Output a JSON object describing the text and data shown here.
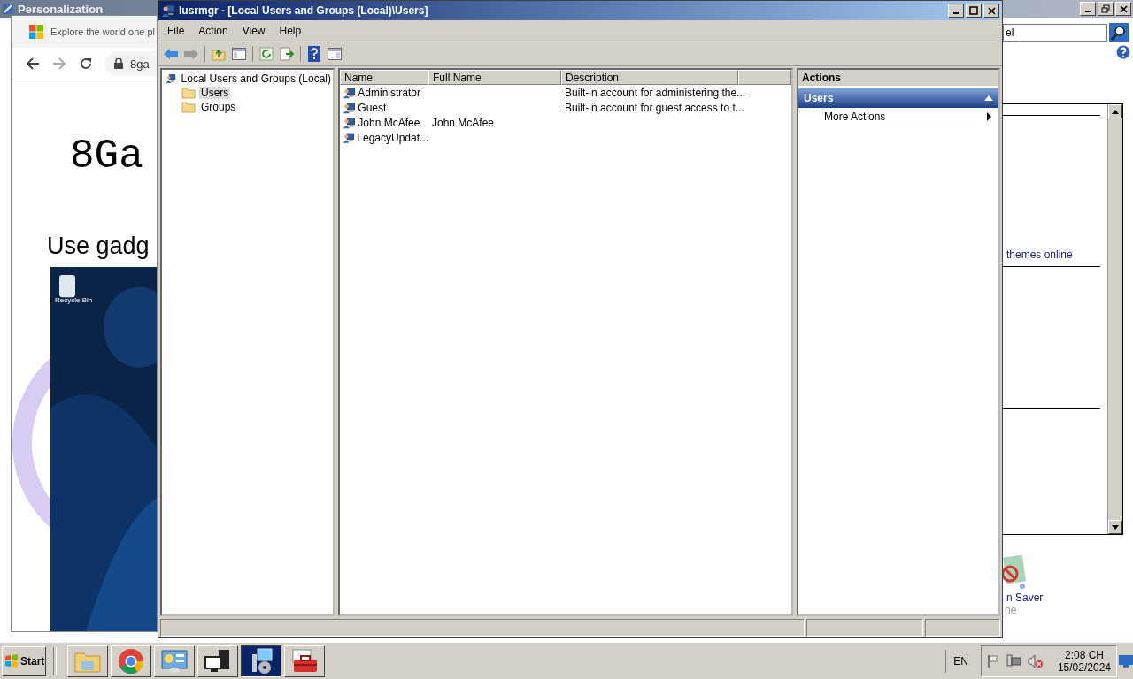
{
  "personalization_window": {
    "title": "Personalization",
    "search_value": "el",
    "link": "themes online",
    "item_label": "n Saver",
    "item_sublabel": "ne"
  },
  "browser_window": {
    "tab_title": "Explore the world one pl",
    "address": "8ga",
    "heading": "8Ga",
    "subheading": "Use gadg",
    "desktop_icon_label": "Recycle Bin"
  },
  "window": {
    "title": "lusrmgr - [Local Users and Groups (Local)\\Users]",
    "menu": [
      "File",
      "Action",
      "View",
      "Help"
    ],
    "tree": [
      {
        "label": "Local Users and Groups (Local)",
        "selected": false,
        "children": [
          {
            "label": "Users",
            "selected": true
          },
          {
            "label": "Groups",
            "selected": false
          }
        ]
      }
    ],
    "table": {
      "columns": [
        "Name",
        "Full Name",
        "Description"
      ],
      "rows": [
        {
          "name": "Administrator",
          "description": "Built-in account for administering the..."
        },
        {
          "name": "Guest",
          "description": "Built-in account for guest access to t..."
        },
        {
          "name": "John McAfee",
          "full_name": "John McAfee"
        },
        {
          "name": "LegacyUpdat..."
        }
      ]
    },
    "actions": {
      "title": "Actions",
      "sections": [
        {
          "label": "Users",
          "expanded": true,
          "items": [
            "More Actions"
          ]
        }
      ]
    }
  },
  "taskbar": {
    "start": "Start",
    "apps": [
      {
        "kind": "folder",
        "selected": false
      },
      {
        "kind": "chrome",
        "selected": false
      },
      {
        "kind": "control",
        "selected": false
      },
      {
        "kind": "computer",
        "selected": false
      },
      {
        "kind": "setup",
        "selected": true
      },
      {
        "kind": "toolbox",
        "selected": false
      }
    ],
    "language": "EN",
    "time": "2:08 CH",
    "date": "15/02/2024"
  }
}
